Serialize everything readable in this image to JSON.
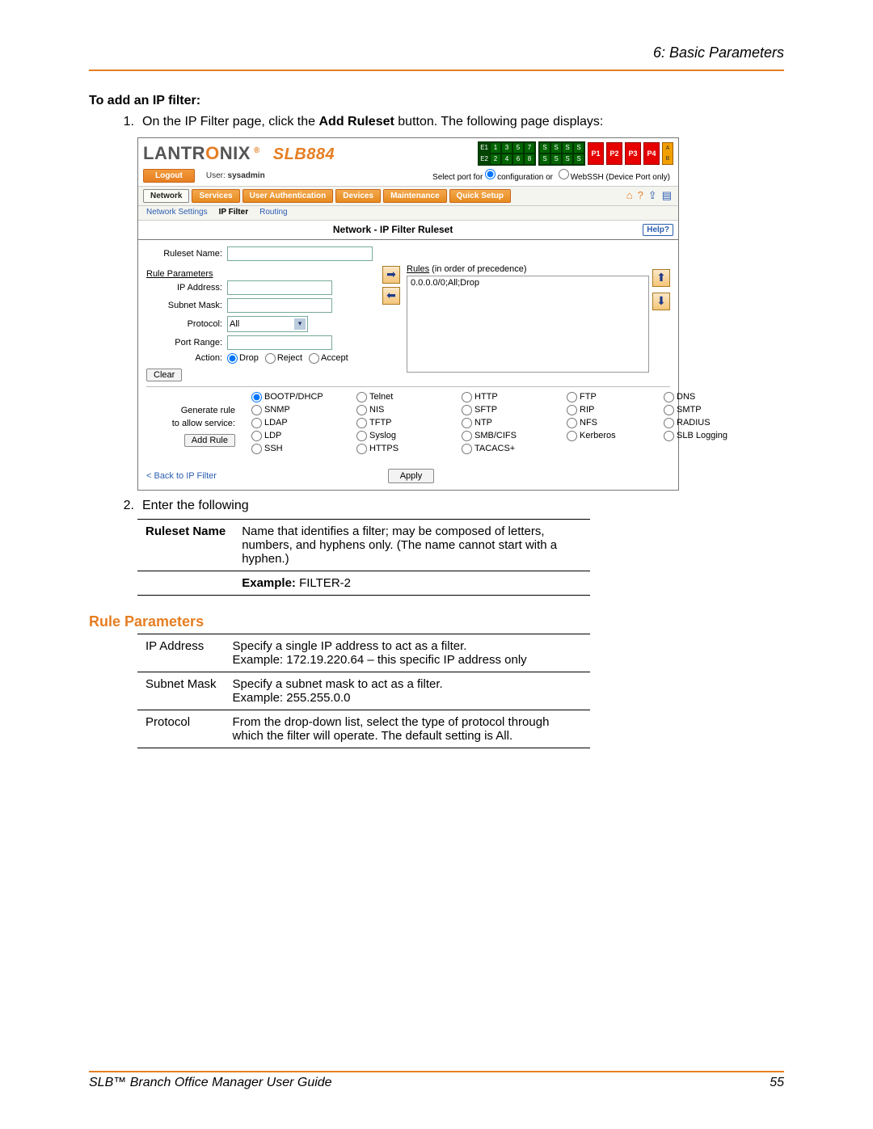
{
  "header": {
    "chapter": "6: Basic Parameters"
  },
  "intro": {
    "to_add": "To add an IP filter:",
    "step1_pre": "On the IP Filter page, click the ",
    "step1_bold": "Add Ruleset",
    "step1_post": " button. The following page displays:",
    "step2": "Enter the following"
  },
  "screenshot": {
    "brand": "LANTRONIX",
    "model": "SLB884",
    "ports": {
      "e1": "E1",
      "e2": "E2",
      "nums": [
        "1",
        "2",
        "3",
        "4",
        "5",
        "6",
        "7",
        "8"
      ],
      "s": "S",
      "p": [
        "P1",
        "P2",
        "P3",
        "P4"
      ],
      "a": "A",
      "b": "B"
    },
    "logout": "Logout",
    "user_label": "User: ",
    "user_value": "sysadmin",
    "portselect_pre": "Select port for ",
    "portselect_conf": "configuration  or",
    "portselect_web": "WebSSH (Device Port only)",
    "tabs": [
      "Network",
      "Services",
      "User Authentication",
      "Devices",
      "Maintenance",
      "Quick Setup"
    ],
    "subtabs": [
      "Network Settings",
      "IP Filter",
      "Routing"
    ],
    "panel_title": "Network - IP Filter Ruleset",
    "help": "Help?",
    "ruleset_name_label": "Ruleset Name:",
    "rule_params_hdr": "Rule Parameters",
    "rules_hdr_u": "Rules",
    "rules_hdr_rest": " (in order of precedence)",
    "rule0": "0.0.0.0/0;All;Drop",
    "labels": {
      "ip": "IP Address:",
      "mask": "Subnet Mask:",
      "protocol": "Protocol:",
      "protocol_val": "All",
      "port": "Port Range:",
      "action": "Action:",
      "drop": "Drop",
      "reject": "Reject",
      "accept": "Accept"
    },
    "clear": "Clear",
    "gen_label1": "Generate rule",
    "gen_label2": "to allow service:",
    "add_rule": "Add Rule",
    "services": [
      [
        "BOOTP/DHCP",
        "Telnet",
        "HTTP",
        "FTP"
      ],
      [
        "DNS",
        "SNMP",
        "NIS",
        "SFTP"
      ],
      [
        "RIP",
        "SMTP",
        "LDAP",
        "TFTP"
      ],
      [
        "NTP",
        "NFS",
        "RADIUS",
        "LDP"
      ],
      [
        "Syslog",
        "SMB/CIFS",
        "Kerberos",
        "SLB Logging"
      ],
      [
        "SSH",
        "HTTPS",
        "TACACS+",
        ""
      ]
    ],
    "back": "< Back to IP Filter",
    "apply": "Apply"
  },
  "table1": {
    "ruleset_name_key": "Ruleset Name",
    "ruleset_name_val": "Name that identifies a filter; may be composed of letters, numbers, and hyphens only. (The name cannot start with a hyphen.)",
    "example_label": "Example:",
    "example_val": " FILTER-2"
  },
  "rule_params_title": "Rule Parameters",
  "table2": [
    {
      "key": "IP Address",
      "val": "Specify a single IP address to act as a filter.",
      "ex": "Example: 172.19.220.64 – this specific IP address only"
    },
    {
      "key": "Subnet Mask",
      "val": "Specify a subnet mask to act as a filter.",
      "ex": "Example: 255.255.0.0"
    },
    {
      "key": "Protocol",
      "val": "From the drop-down list, select the type of protocol through which the filter will operate. The default setting is All.",
      "ex": ""
    }
  ],
  "footer": {
    "left": "SLB™ Branch Office Manager User Guide",
    "right": "55"
  }
}
